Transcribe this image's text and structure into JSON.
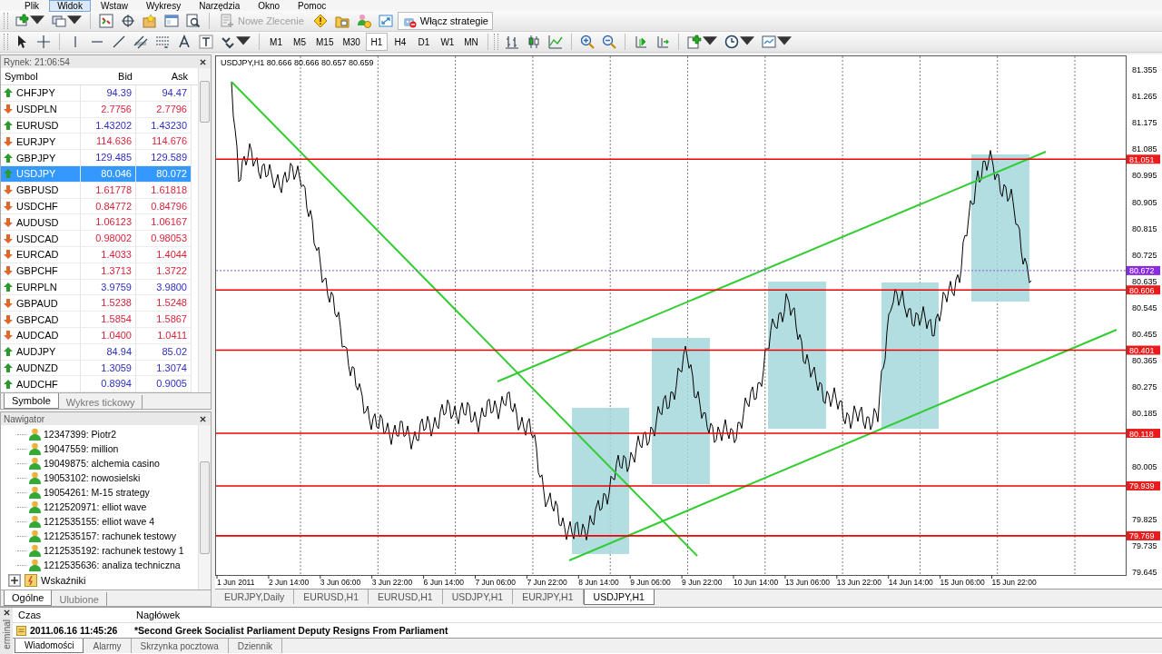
{
  "menu": [
    {
      "label": "Plik",
      "hovered": false
    },
    {
      "label": "Widok",
      "hovered": true
    },
    {
      "label": "Wstaw",
      "hovered": false
    },
    {
      "label": "Wykresy",
      "hovered": false
    },
    {
      "label": "Narzędzia",
      "hovered": false
    },
    {
      "label": "Okno",
      "hovered": false
    },
    {
      "label": "Pomoc",
      "hovered": false
    }
  ],
  "toolbar": {
    "new_order": {
      "label": "Nowe Zlecenie",
      "disabled": true
    },
    "strategies": {
      "label": "Włącz strategie",
      "disabled": false
    }
  },
  "timeframes": [
    {
      "label": "M1",
      "selected": false
    },
    {
      "label": "M5",
      "selected": false
    },
    {
      "label": "M15",
      "selected": false
    },
    {
      "label": "M30",
      "selected": false
    },
    {
      "label": "H1",
      "selected": true
    },
    {
      "label": "H4",
      "selected": false
    },
    {
      "label": "D1",
      "selected": false
    },
    {
      "label": "W1",
      "selected": false
    },
    {
      "label": "MN",
      "selected": false
    }
  ],
  "market_watch": {
    "title": "Rynek: 21:06:54",
    "columns": [
      "Symbol",
      "Bid",
      "Ask"
    ],
    "rows": [
      {
        "symbol": "CHFJPY",
        "bid": "94.39",
        "ask": "94.47",
        "rising": true,
        "selected": false
      },
      {
        "symbol": "USDPLN",
        "bid": "2.7756",
        "ask": "2.7796",
        "rising": false,
        "selected": false
      },
      {
        "symbol": "EURUSD",
        "bid": "1.43202",
        "ask": "1.43230",
        "rising": true,
        "selected": false
      },
      {
        "symbol": "EURJPY",
        "bid": "114.636",
        "ask": "114.676",
        "rising": false,
        "selected": false
      },
      {
        "symbol": "GBPJPY",
        "bid": "129.485",
        "ask": "129.589",
        "rising": true,
        "selected": false
      },
      {
        "symbol": "USDJPY",
        "bid": "80.046",
        "ask": "80.072",
        "rising": true,
        "selected": true
      },
      {
        "symbol": "GBPUSD",
        "bid": "1.61778",
        "ask": "1.61818",
        "rising": false,
        "selected": false
      },
      {
        "symbol": "USDCHF",
        "bid": "0.84772",
        "ask": "0.84796",
        "rising": false,
        "selected": false
      },
      {
        "symbol": "AUDUSD",
        "bid": "1.06123",
        "ask": "1.06167",
        "rising": false,
        "selected": false
      },
      {
        "symbol": "USDCAD",
        "bid": "0.98002",
        "ask": "0.98053",
        "rising": false,
        "selected": false
      },
      {
        "symbol": "EURCAD",
        "bid": "1.4033",
        "ask": "1.4044",
        "rising": false,
        "selected": false
      },
      {
        "symbol": "GBPCHF",
        "bid": "1.3713",
        "ask": "1.3722",
        "rising": false,
        "selected": false
      },
      {
        "symbol": "EURPLN",
        "bid": "3.9759",
        "ask": "3.9800",
        "rising": true,
        "selected": false
      },
      {
        "symbol": "GBPAUD",
        "bid": "1.5238",
        "ask": "1.5248",
        "rising": false,
        "selected": false
      },
      {
        "symbol": "GBPCAD",
        "bid": "1.5854",
        "ask": "1.5867",
        "rising": false,
        "selected": false
      },
      {
        "symbol": "AUDCAD",
        "bid": "1.0400",
        "ask": "1.0411",
        "rising": false,
        "selected": false
      },
      {
        "symbol": "AUDJPY",
        "bid": "84.94",
        "ask": "85.02",
        "rising": true,
        "selected": false
      },
      {
        "symbol": "AUDNZD",
        "bid": "1.3059",
        "ask": "1.3074",
        "rising": true,
        "selected": false
      },
      {
        "symbol": "AUDCHF",
        "bid": "0.8994",
        "ask": "0.9005",
        "rising": true,
        "selected": false
      }
    ],
    "tabs": [
      {
        "label": "Symbole",
        "selected": true
      },
      {
        "label": "Wykres tickowy",
        "selected": false
      }
    ]
  },
  "navigator": {
    "title": "Nawigator",
    "accounts": [
      "12347399: Piotr2",
      "19047559: million",
      "19049875: alchemia casino",
      "19053102: nowosielski",
      "19054261: M-15 strategy",
      "1212520971: elliot wave",
      "1212535155: elliot wave 4",
      "1212535157: rachunek testowy",
      "1212535192: rachunek testowy 1",
      "1212535636: analiza techniczna"
    ],
    "sections": [
      {
        "label": "Wskaźniki",
        "expanded": false
      }
    ],
    "tabs": [
      {
        "label": "Ogólne",
        "selected": true
      },
      {
        "label": "Ulubione",
        "selected": false
      }
    ]
  },
  "chart": {
    "header": "USDJPY,H1  80.666 80.666 80.657 80.659",
    "price_ticks": [
      "81.355",
      "81.265",
      "81.175",
      "81.085",
      "80.995",
      "80.905",
      "80.815",
      "80.725",
      "80.635",
      "80.545",
      "80.455",
      "80.365",
      "80.275",
      "80.185",
      "80.005",
      "79.825",
      "79.735",
      "79.645"
    ],
    "levels": [
      {
        "label": "81.051",
        "kind": "level"
      },
      {
        "label": "80.672",
        "kind": "bid"
      },
      {
        "label": "80.606",
        "kind": "level"
      },
      {
        "label": "80.401",
        "kind": "level"
      },
      {
        "label": "80.118",
        "kind": "level"
      },
      {
        "label": "79.939",
        "kind": "level"
      },
      {
        "label": "79.769",
        "kind": "level"
      }
    ],
    "time_ticks": [
      "1 Jun 2011",
      "2 Jun 14:00",
      "3 Jun 06:00",
      "3 Jun 22:00",
      "6 Jun 14:00",
      "7 Jun 06:00",
      "7 Jun 22:00",
      "8 Jun 14:00",
      "9 Jun 06:00",
      "9 Jun 22:00",
      "10 Jun 14:00",
      "13 Jun 06:00",
      "13 Jun 22:00",
      "14 Jun 14:00",
      "15 Jun 06:00",
      "15 Jun 22:00"
    ],
    "tabs": [
      {
        "label": "EURJPY,Daily",
        "selected": false
      },
      {
        "label": "EURUSD,H1",
        "selected": false
      },
      {
        "label": "EURUSD,H1",
        "selected": false
      },
      {
        "label": "USDJPY,H1",
        "selected": false
      },
      {
        "label": "EURJPY,H1",
        "selected": false
      },
      {
        "label": "USDJPY,H1",
        "selected": true
      }
    ]
  },
  "terminal": {
    "side_label": "erminal",
    "columns": [
      "Czas",
      "Nagłówek"
    ],
    "rows": [
      {
        "time": "2011.06.16 11:45:26",
        "headline": "*Second Greek Socialist Parliament Deputy Resigns From Parliament"
      }
    ],
    "tabs": [
      {
        "label": "Wiadomości",
        "selected": true
      },
      {
        "label": "Alarmy",
        "selected": false
      },
      {
        "label": "Skrzynka pocztowa",
        "selected": false
      },
      {
        "label": "Dziennik",
        "selected": false
      }
    ]
  }
}
